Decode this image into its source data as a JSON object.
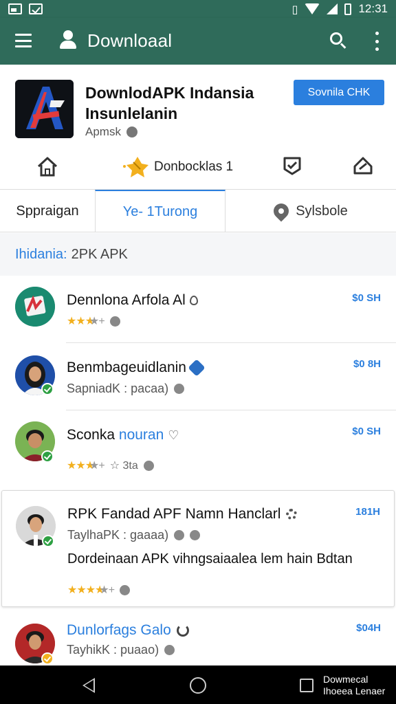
{
  "status_bar": {
    "time": "12:31"
  },
  "app_bar": {
    "title": "Downloaal"
  },
  "header": {
    "title_line1": "DownlodAPK Indansia",
    "title_line2": "Insunlelanin",
    "subtitle": "Apmsk",
    "action_button": "Sovnila CHK"
  },
  "icon_row": {
    "downloads_label": "Donbocklas 1"
  },
  "tabs": [
    {
      "label": "Sppraigan"
    },
    {
      "label": "Ye- 1Turong"
    },
    {
      "label": "Sylsbole"
    }
  ],
  "section": {
    "label_blue": "Ihidania:",
    "label_rest": "2PK APK"
  },
  "list": [
    {
      "name": "Dennlona Arfola Al",
      "time": "$0 SH",
      "rating_filled": "★★★",
      "rating_empty": "★+"
    },
    {
      "name": "Benmbageuidlanin",
      "time": "$0 8H",
      "meta": "SapniadK : pacaa)"
    },
    {
      "name_part1": "Sconka",
      "name_part2": "nouran",
      "time": "$0 SH",
      "rating_filled": "★★★",
      "rating_empty": "★+",
      "rating_extra": "☆ 3ta"
    },
    {
      "name": "RPK Fandad APF Namn Hanclarl",
      "time": "181H",
      "meta": "TaylhaPK : gaaaa)",
      "description": "Dordeinaan APK vihngsaiaalea lem hain Bdtan",
      "rating_filled": "★★★★",
      "rating_empty": "★+"
    },
    {
      "name": "Dunlorfags",
      "name_part2": "Galo",
      "time": "$04H",
      "meta": "TayhikK : puaao)"
    }
  ],
  "nav_bar": {
    "text_line1": "Dowmecal",
    "text_line2": "Ihoeea Lenaer"
  },
  "colors": {
    "primary": "#2f6b5a",
    "accent": "#2b7fde",
    "star": "#f2b01e"
  }
}
